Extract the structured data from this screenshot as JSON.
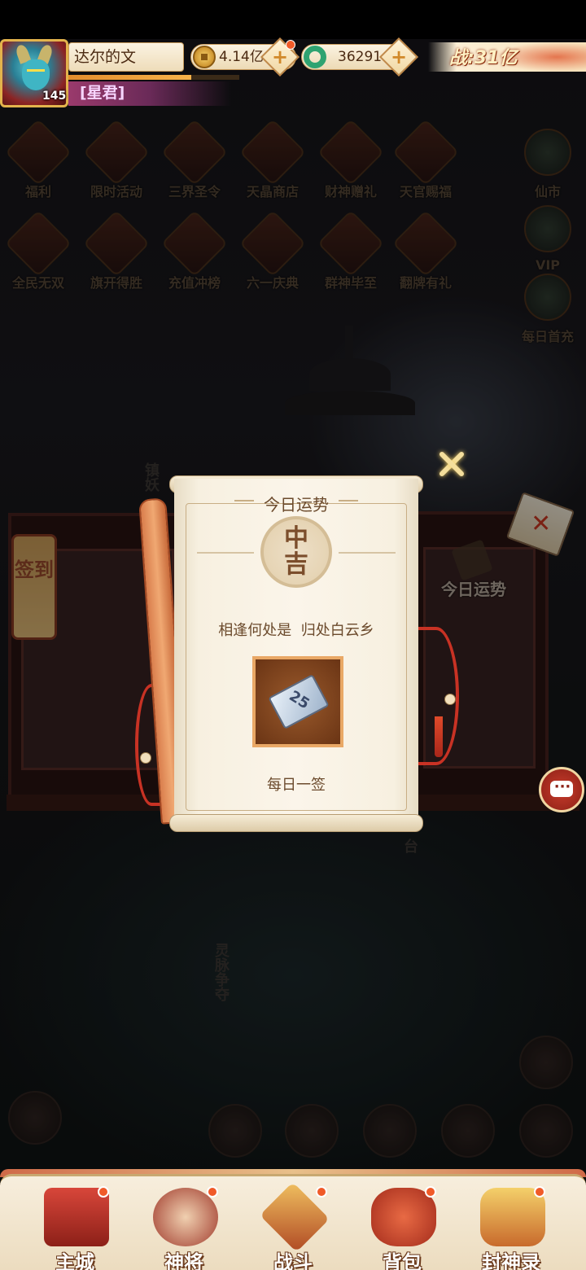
{
  "player": {
    "name": "达尔的文",
    "level": "145",
    "title": "[星君]",
    "exp_fraction": 0.72
  },
  "resources": {
    "gold": "4.14亿",
    "jade": "36291",
    "power": "战:31亿",
    "plus": "+"
  },
  "activity_icons": [
    {
      "label": "福利"
    },
    {
      "label": "限时活动"
    },
    {
      "label": "三界圣令"
    },
    {
      "label": "天晶商店"
    },
    {
      "label": "财神赠礼"
    },
    {
      "label": "天官赐福"
    },
    {
      "label": "仙市"
    },
    {
      "label": "全民无双"
    },
    {
      "label": "旗开得胜"
    },
    {
      "label": "充值冲榜"
    },
    {
      "label": "六一庆典"
    },
    {
      "label": "群神毕至"
    },
    {
      "label": "翻牌有礼"
    },
    {
      "label": "VIP"
    },
    {
      "label": "每日首充"
    }
  ],
  "scene": {
    "signin_label": "签到",
    "fortune_label": "今日运势",
    "demon_label": "镇妖",
    "spirit_label": "灵脉争夺",
    "stage_label": "台",
    "chat_icon": "···"
  },
  "fortune_modal": {
    "title": "今日运势",
    "rank_top": "中",
    "rank_bottom": "吉",
    "verse": "相逢何处是  归处白云乡",
    "reward_value": "25",
    "reward_name": "每日一签"
  },
  "bottom_nav": [
    {
      "label": "主城"
    },
    {
      "label": "神将"
    },
    {
      "label": "战斗"
    },
    {
      "label": "背包"
    },
    {
      "label": "封神录"
    }
  ],
  "colors": {
    "accent": "#c83224",
    "badge": "#f05a28",
    "scroll": "#fbf5ea",
    "text_brown": "#6b4a2c"
  }
}
